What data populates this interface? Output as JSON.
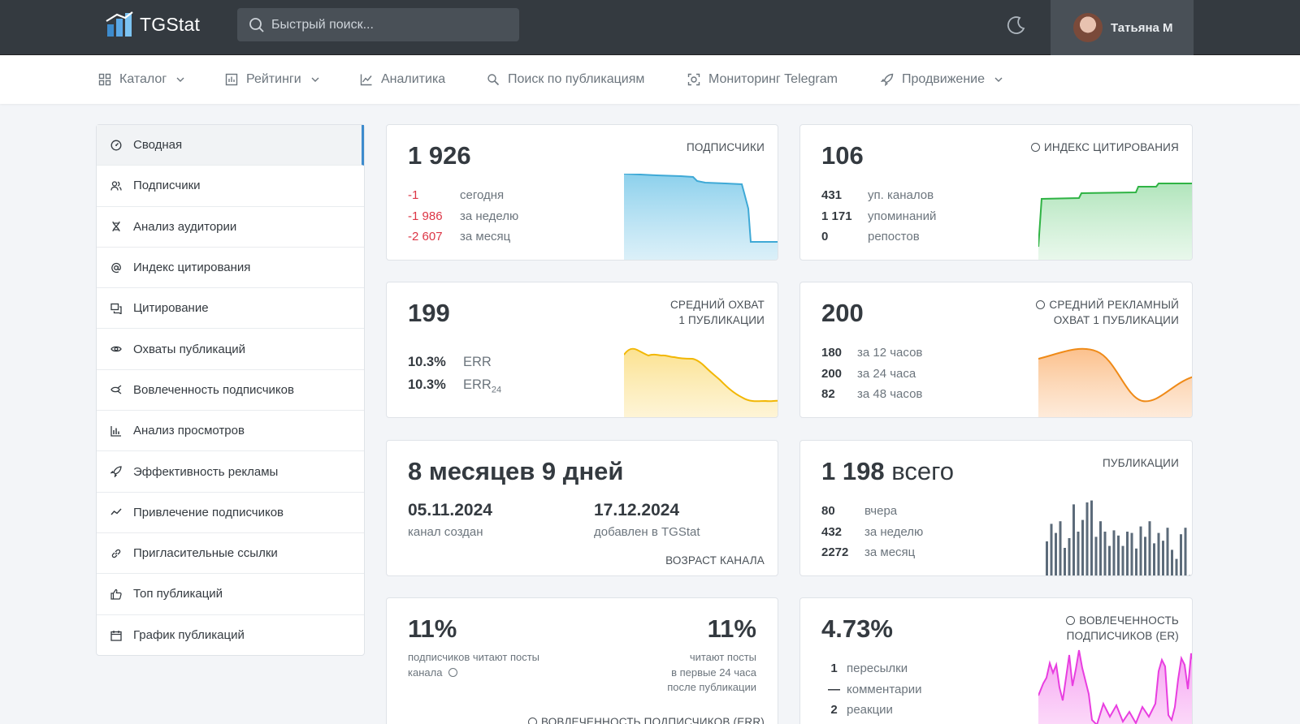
{
  "header": {
    "logo_text": "TGStat",
    "search_placeholder": "Быстрый поиск...",
    "theme_icon": "moon-icon",
    "user_name": "Татьяна М"
  },
  "nav": {
    "items": [
      {
        "label": "Каталог",
        "icon": "grid-icon",
        "dropdown": true
      },
      {
        "label": "Рейтинги",
        "icon": "bar-chart-icon",
        "dropdown": true
      },
      {
        "label": "Аналитика",
        "icon": "line-chart-icon",
        "dropdown": false
      },
      {
        "label": "Поиск по публикациям",
        "icon": "search-doc-icon",
        "dropdown": false
      },
      {
        "label": "Мониторинг Telegram",
        "icon": "scan-icon",
        "dropdown": false
      },
      {
        "label": "Продвижение",
        "icon": "rocket-icon",
        "dropdown": true
      }
    ]
  },
  "sidebar": {
    "items": [
      {
        "label": "Сводная",
        "icon": "dashboard-icon",
        "active": true
      },
      {
        "label": "Подписчики",
        "icon": "users-icon"
      },
      {
        "label": "Анализ аудитории",
        "icon": "dna-icon"
      },
      {
        "label": "Индекс цитирования",
        "icon": "at-icon"
      },
      {
        "label": "Цитирование",
        "icon": "quote-icon"
      },
      {
        "label": "Охваты публикаций",
        "icon": "eye-icon"
      },
      {
        "label": "Вовлеченность подписчиков",
        "icon": "engagement-icon"
      },
      {
        "label": "Анализ просмотров",
        "icon": "chart-bars-icon"
      },
      {
        "label": "Эффективность рекламы",
        "icon": "rocket-icon"
      },
      {
        "label": "Привлечение подписчиков",
        "icon": "trend-icon"
      },
      {
        "label": "Пригласительные ссылки",
        "icon": "link-icon"
      },
      {
        "label": "Топ публикаций",
        "icon": "thumbs-up-icon"
      },
      {
        "label": "График публикаций",
        "icon": "calendar-icon"
      }
    ]
  },
  "cards": {
    "subscribers": {
      "value": "1 926",
      "label": "ПОДПИСЧИКИ",
      "rows": [
        {
          "v": "-1",
          "t": "сегодня"
        },
        {
          "v": "-1 986",
          "t": "за неделю"
        },
        {
          "v": "-2 607",
          "t": "за месяц"
        }
      ]
    },
    "citation": {
      "value": "106",
      "label": "ИНДЕКС ЦИТИРОВАНИЯ",
      "rows": [
        {
          "v": "431",
          "t": "уп. каналов"
        },
        {
          "v": "1 171",
          "t": "упоминаний"
        },
        {
          "v": "0",
          "t": "репостов"
        }
      ]
    },
    "reach": {
      "value": "199",
      "label_1": "СРЕДНИЙ ОХВАТ",
      "label_2": "1 ПУБЛИКАЦИИ",
      "rows": [
        {
          "v": "10.3%",
          "t": "ERR"
        },
        {
          "v": "10.3%",
          "t": "ERR",
          "sub": "24"
        }
      ]
    },
    "ad_reach": {
      "value": "200",
      "label_1": "СРЕДНИЙ РЕКЛАМНЫЙ",
      "label_2": "ОХВАТ 1 ПУБЛИКАЦИИ",
      "rows": [
        {
          "v": "180",
          "t": "за 12 часов"
        },
        {
          "v": "200",
          "t": "за 24 часа"
        },
        {
          "v": "82",
          "t": "за 48 часов"
        }
      ]
    },
    "age": {
      "value": "8 месяцев 9 дней",
      "created_date": "05.11.2024",
      "created_label": "канал создан",
      "added_date": "17.12.2024",
      "added_label": "добавлен в TGStat",
      "label": "ВОЗРАСТ КАНАЛА"
    },
    "posts": {
      "value": "1 198",
      "value_suffix": "всего",
      "label": "ПУБЛИКАЦИИ",
      "rows": [
        {
          "v": "80",
          "t": "вчера"
        },
        {
          "v": "432",
          "t": "за неделю"
        },
        {
          "v": "2272",
          "t": "за месяц"
        }
      ]
    },
    "read_share": {
      "left_value": "11%",
      "left_text_1": "подписчиков читают посты",
      "left_text_2": "канала",
      "right_value": "11%",
      "right_text_1": "читают посты",
      "right_text_2": "в первые 24 часа",
      "right_text_3": "после публикации",
      "label": "ВОВЛЕЧЕННОСТЬ ПОДПИСЧИКОВ (ERR)"
    },
    "er": {
      "value": "4.73%",
      "label_1": "ВОВЛЕЧЕННОСТЬ",
      "label_2": "ПОДПИСЧИКОВ (ER)",
      "rows": [
        {
          "v": "1",
          "t": "пересылки"
        },
        {
          "v": "—",
          "t": "комментарии"
        },
        {
          "v": "2",
          "t": "реакции"
        }
      ]
    }
  },
  "colors": {
    "topbar": "#343a40",
    "accent": "#3d8bcd",
    "negative": "#dc3545",
    "subscribers_chart": "#3fa9d6",
    "citation_chart": "#2fb344",
    "reach_chart": "#f2b705",
    "ad_reach_chart": "#ef8a17",
    "posts_chart": "#5c6b7a",
    "er_chart": "#e83ee0"
  }
}
